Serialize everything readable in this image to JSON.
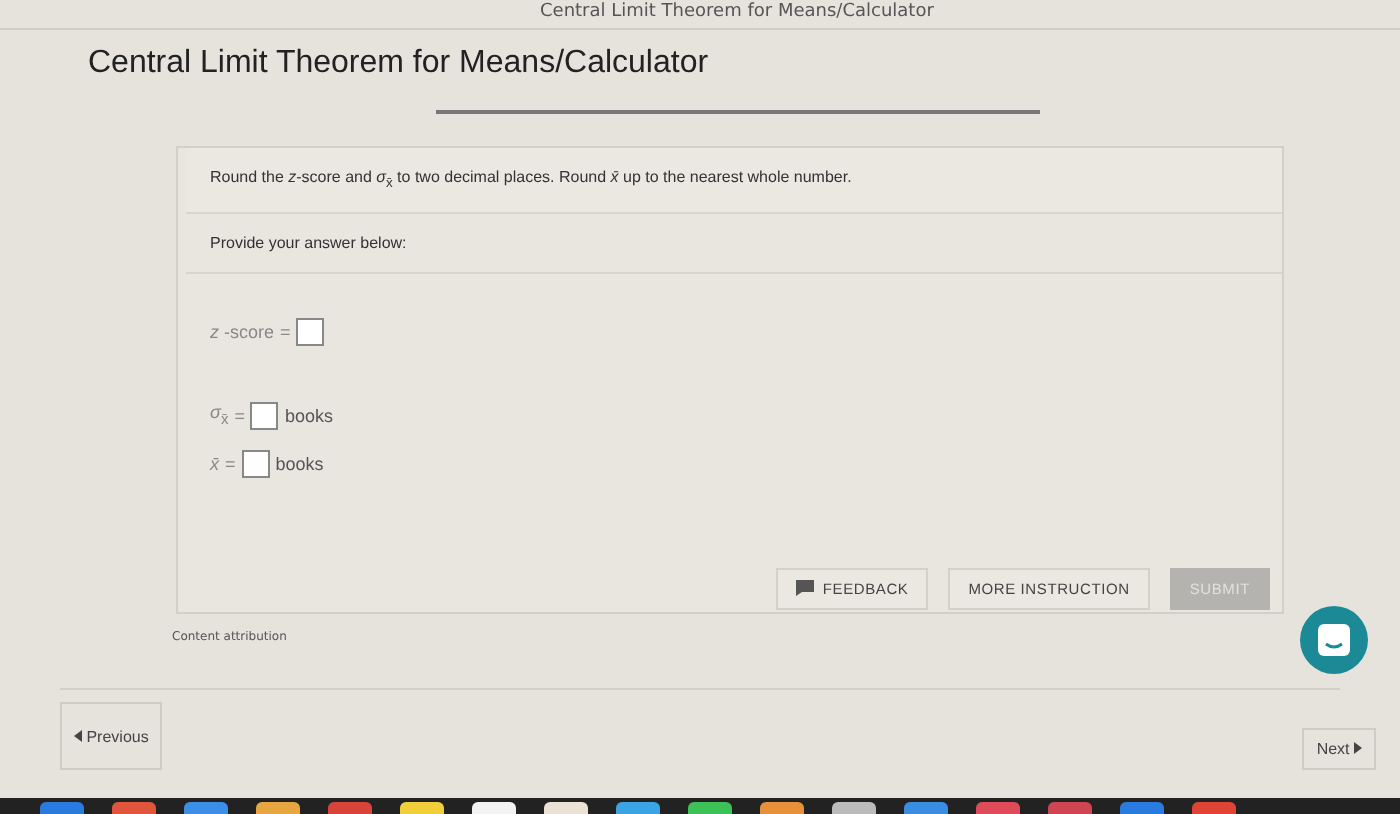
{
  "breadcrumb": "Central Limit Theorem for Means/Calculator",
  "title": "Central Limit Theorem for Means/Calculator",
  "instruction": "Round the *z*-score and *σ*$_{x̄}$ to two decimal places. Round *x̄* up to the nearest whole number.",
  "prompt": "Provide your answer below:",
  "answers": [
    {
      "label": "*z* -score",
      "equals": "="
    },
    {
      "label": "*σ*$_{x̄}$",
      "equals": "=",
      "unit": "books"
    },
    {
      "label": "*x̄*",
      "equals": "=",
      "unit": "books"
    }
  ],
  "buttons": [
    {
      "label": "FEEDBACK",
      "kind": "feedback",
      "disabled": false
    },
    {
      "label": "MORE INSTRUCTION",
      "kind": "plain",
      "disabled": false
    },
    {
      "label": "SUBMIT",
      "kind": "submit",
      "disabled": true
    }
  ],
  "attribution": "Content attribution",
  "nav": {
    "previous": "Previous",
    "next": "Next"
  }
}
